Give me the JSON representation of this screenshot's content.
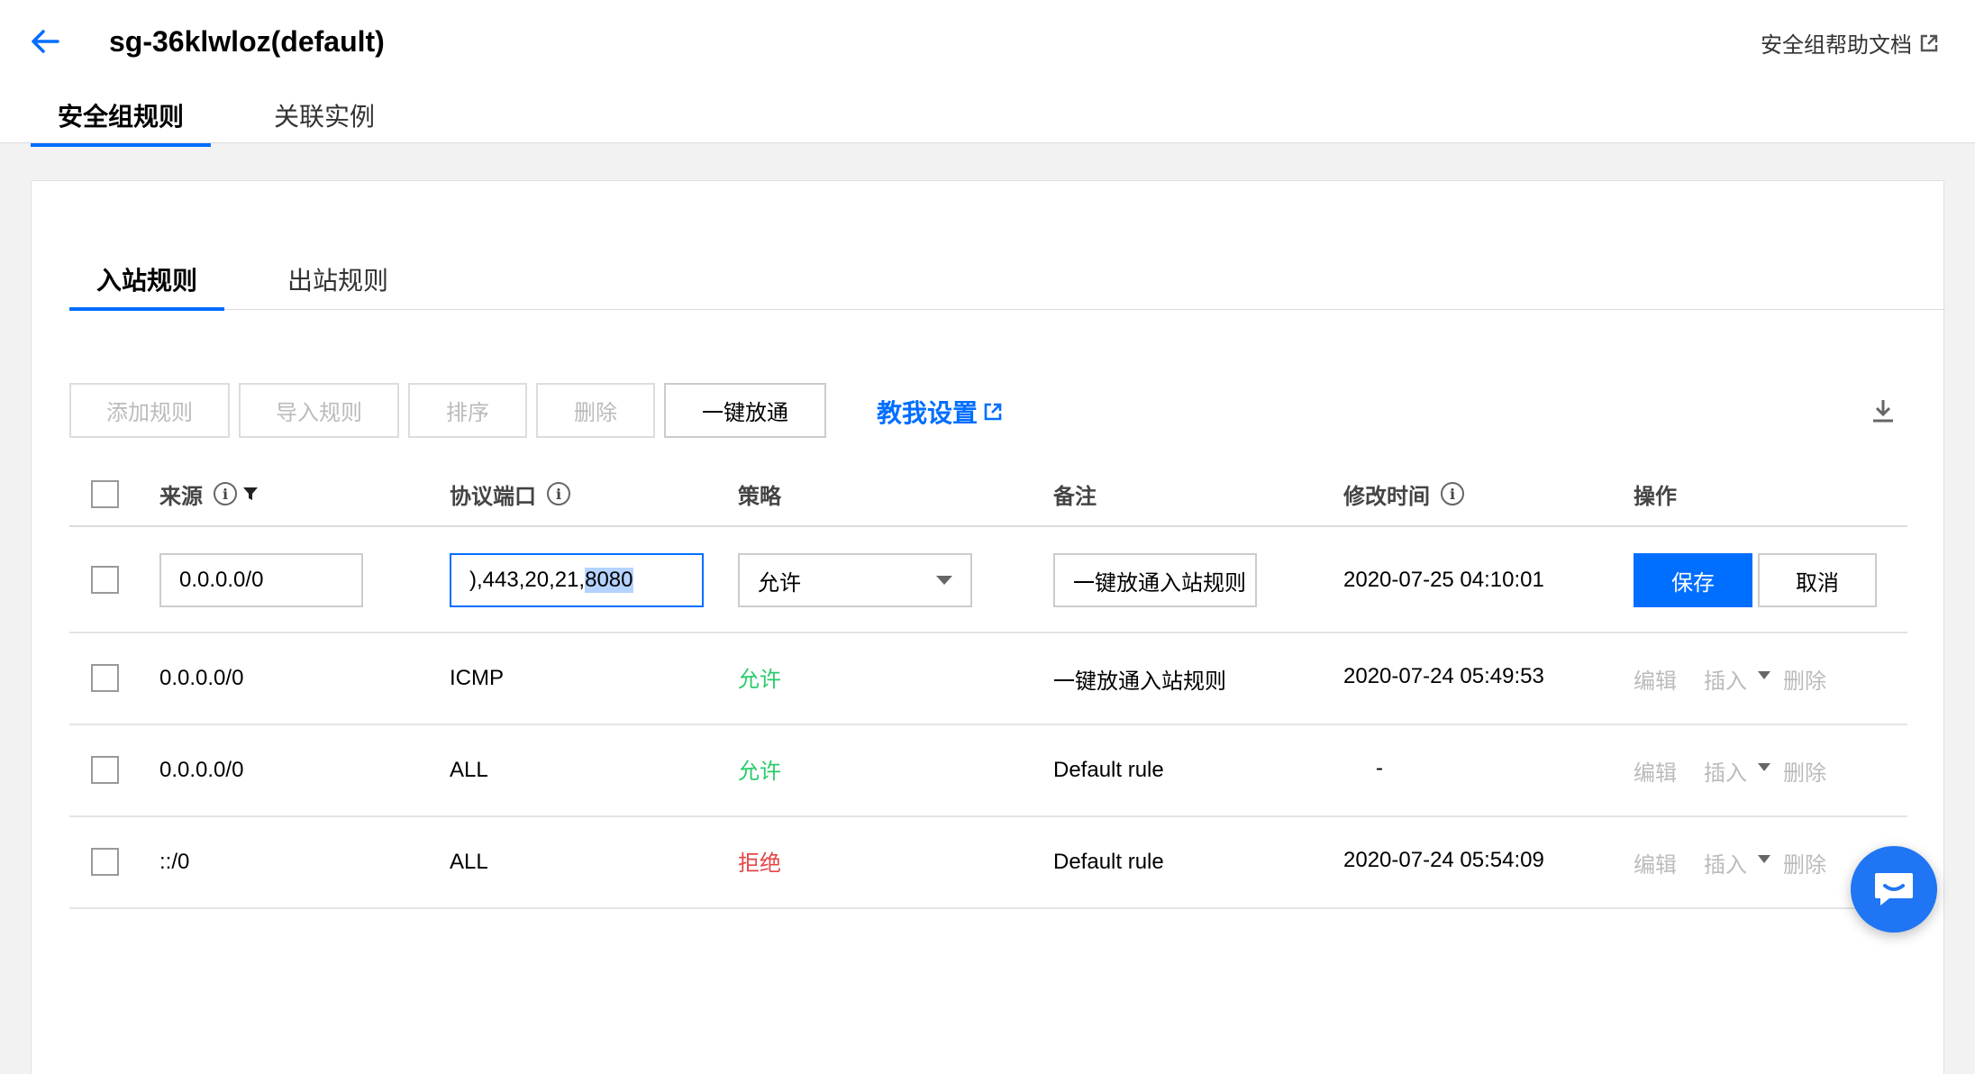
{
  "header": {
    "title": "sg-36klwloz(default)",
    "help_link": "安全组帮助文档"
  },
  "top_tabs": [
    {
      "label": "安全组规则",
      "active": true
    },
    {
      "label": "关联实例",
      "active": false
    }
  ],
  "sub_tabs": [
    {
      "label": "入站规则",
      "active": true
    },
    {
      "label": "出站规则",
      "active": false
    }
  ],
  "toolbar": {
    "add_rule": "添加规则",
    "import_rule": "导入规则",
    "sort": "排序",
    "delete": "删除",
    "one_click_open": "一键放通",
    "teach_me": "教我设置"
  },
  "columns": {
    "source": "来源",
    "protocol_port": "协议端口",
    "policy": "策略",
    "remark": "备注",
    "modified_time": "修改时间",
    "actions": "操作"
  },
  "edit_row": {
    "source_value": "0.0.0.0/0",
    "port_value_prefix": "),443,20,21,",
    "port_value_selected": "8080",
    "policy_value": "允许",
    "remark_value": "一键放通入站规则",
    "modified_time": "2020-07-25 04:10:01",
    "save_label": "保存",
    "cancel_label": "取消"
  },
  "rows": [
    {
      "source": "0.0.0.0/0",
      "protocol": "ICMP",
      "policy": "允许",
      "remark": "一键放通入站规则",
      "time": "2020-07-24 05:49:53"
    },
    {
      "source": "0.0.0.0/0",
      "protocol": "ALL",
      "policy": "允许",
      "remark": "Default rule",
      "time": "-"
    },
    {
      "source": "::/0",
      "protocol": "ALL",
      "policy": "拒绝",
      "remark": "Default rule",
      "time": "2020-07-24 05:54:09"
    }
  ],
  "row_actions": {
    "edit": "编辑",
    "insert": "插入",
    "delete": "删除"
  },
  "colors": {
    "accent": "#006eff",
    "allow": "#29cc6a",
    "deny": "#e54545"
  }
}
